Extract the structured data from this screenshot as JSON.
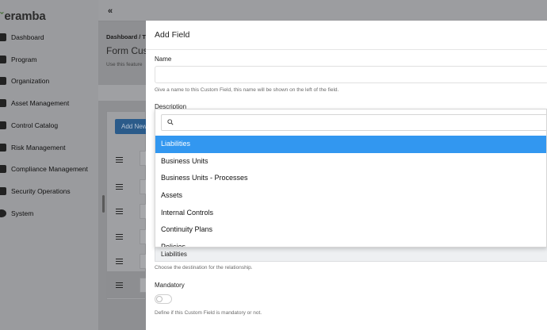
{
  "app": {
    "logo": "eramba"
  },
  "sidebar": {
    "items": [
      {
        "label": "Dashboard",
        "icon": "dashboard-icon"
      },
      {
        "label": "Program",
        "icon": "program-icon"
      },
      {
        "label": "Organization",
        "icon": "organization-icon"
      },
      {
        "label": "Asset Management",
        "icon": "asset-icon"
      },
      {
        "label": "Control Catalog",
        "icon": "catalog-icon"
      },
      {
        "label": "Risk Management",
        "icon": "risk-icon"
      },
      {
        "label": "Compliance Management",
        "icon": "compliance-icon"
      },
      {
        "label": "Security Operations",
        "icon": "security-icon"
      },
      {
        "label": "System",
        "icon": "gear-icon"
      }
    ]
  },
  "topbar": {
    "collapse_glyph": "«"
  },
  "background": {
    "breadcrumb": "Dashboard  /  T",
    "title": "Form Custom",
    "description": "Use this feature",
    "add_new": "Add New"
  },
  "modal": {
    "title": "Add Field",
    "name_label": "Name",
    "name_value": "",
    "name_help": "Give a name to this Custom Field, this name will be shown on the left of the field.",
    "description_label": "Description",
    "dropdown": {
      "search_value": "",
      "options": [
        {
          "label": "Liabilities",
          "selected": true
        },
        {
          "label": "Business Units",
          "selected": false
        },
        {
          "label": "Business Units - Processes",
          "selected": false
        },
        {
          "label": "Assets",
          "selected": false
        },
        {
          "label": "Internal Controls",
          "selected": false
        },
        {
          "label": "Continuity Plans",
          "selected": false
        },
        {
          "label": "Policies",
          "selected": false
        }
      ]
    },
    "destination_value": "Liabilities",
    "destination_help": "Choose the destination for the relationship.",
    "mandatory_label": "Mandatory",
    "mandatory_on": false,
    "mandatory_help": "Define if this Custom Field is mandatory or not."
  },
  "colors": {
    "accent": "#3297f0",
    "primary_button": "#2b5b8a"
  }
}
